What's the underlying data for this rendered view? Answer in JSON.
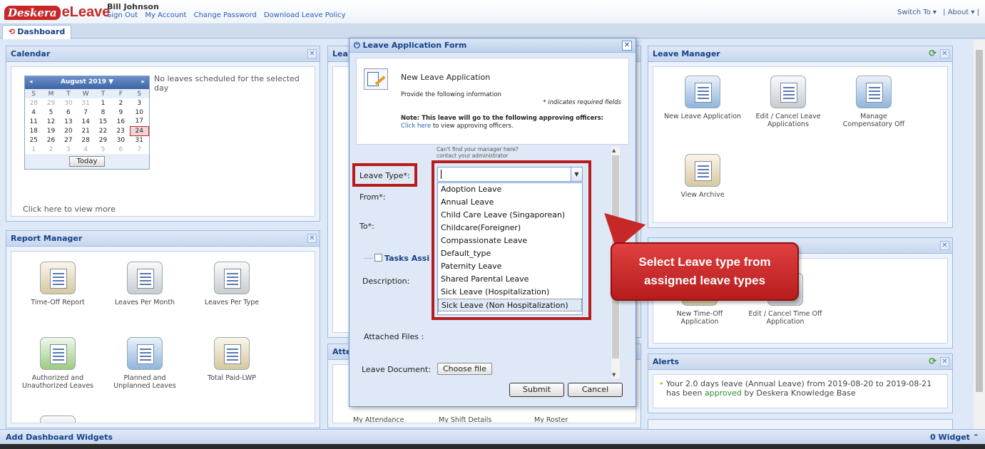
{
  "header": {
    "logo_part1": "Deskera",
    "logo_part2": "eLeave",
    "user_name": "Bill Johnson",
    "links": [
      "Sign Out",
      "My Account",
      "Change Password",
      "Download Leave Policy"
    ],
    "switch_to": "Switch To ▾",
    "about": "| About ▾ |"
  },
  "tabs": {
    "dashboard": "Dashboard"
  },
  "calendar": {
    "title": "Calendar",
    "month_label": "August 2019 ▼",
    "weekdays": [
      "S",
      "M",
      "T",
      "W",
      "T",
      "F",
      "S"
    ],
    "weeks": [
      [
        "28",
        "29",
        "30",
        "31",
        "1",
        "2",
        "3"
      ],
      [
        "4",
        "5",
        "6",
        "7",
        "8",
        "9",
        "10"
      ],
      [
        "11",
        "12",
        "13",
        "14",
        "15",
        "16",
        "17"
      ],
      [
        "18",
        "19",
        "20",
        "21",
        "22",
        "23",
        "24"
      ],
      [
        "25",
        "26",
        "27",
        "28",
        "29",
        "30",
        "31"
      ],
      [
        "1",
        "2",
        "3",
        "4",
        "5",
        "6",
        "7"
      ]
    ],
    "selected_day": "24",
    "today_label": "Today",
    "no_leaves_text": "No leaves scheduled for the selected day",
    "view_more": "Click here to view more"
  },
  "report_manager": {
    "title": "Report Manager",
    "tiles": [
      "Time-Off Report",
      "Leaves Per Month",
      "Leaves Per Type",
      "Authorized and Unauthorized Leaves",
      "Planned and Unplanned Leaves",
      "Total Paid-LWP"
    ]
  },
  "leave_manager": {
    "title": "Leave Manager",
    "tiles": [
      "New Leave Application",
      "Edit / Cancel Leave Applications",
      "Manage Compensatory Off",
      "View Archive"
    ]
  },
  "timeoff": {
    "tiles": [
      "New Time-Off Application",
      "Edit / Cancel Time Off Application"
    ]
  },
  "alerts": {
    "title": "Alerts",
    "message_prefix": "Your 2.0 days leave (Annual Leave) from 2019-08-20 to 2019-08-21 has been ",
    "approved_word": "approved",
    "message_suffix": " by Deskera Knowledge Base"
  },
  "hidden_panels": {
    "leave_title_fragment": "Lea",
    "attendance_title_fragment": "Atte",
    "attendance_tiles": [
      "My Attendance",
      "My Shift Details",
      "My Roster"
    ]
  },
  "modal": {
    "title": "Leave Application Form",
    "heading": "New Leave Application",
    "subheading": "Provide the following information",
    "required_note": "* indicates required fields",
    "approve_note": "Note: This leave will go to the following approving officers:",
    "approve_link": "Click here",
    "approve_link_suffix": " to view approving officers.",
    "manager_hint_1": "Can't find your manager here?",
    "manager_hint_2": "contact your administrator",
    "labels": {
      "leave_type": "Leave Type*:",
      "from": "From*:",
      "to": "To*:",
      "tasks": "Tasks Assi",
      "description": "Description:",
      "attached": "Attached Files :",
      "leave_document": "Leave Document:"
    },
    "choose_file": "Choose file",
    "submit": "Submit",
    "cancel": "Cancel",
    "leave_type_value": "",
    "leave_type_options": [
      "Adoption Leave",
      "Annual Leave",
      "Child Care Leave (Singaporean)",
      "Childcare(Foreigner)",
      "Compassionate Leave",
      "Default_type",
      "Paternity Leave",
      "Shared Parental Leave",
      "Sick Leave (Hospitalization)",
      "Sick Leave (Non Hospitalization)"
    ]
  },
  "callout": {
    "line1": "Select Leave type from",
    "line2": "assigned leave types"
  },
  "footer": {
    "add_widgets": "Add Dashboard Widgets",
    "widget_count": "0 Widget"
  },
  "colors": {
    "highlight_red": "#b71c1c",
    "panel_title": "#15428b",
    "brand_red": "#c62828"
  }
}
